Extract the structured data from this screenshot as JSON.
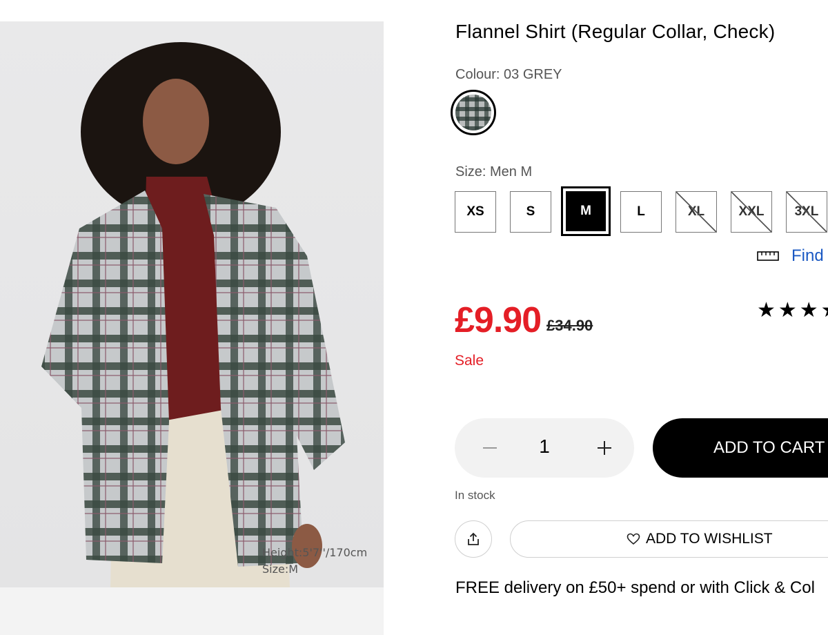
{
  "product": {
    "title": "Flannel Shirt (Regular Collar, Check)",
    "colour_label": "Colour: 03 GREY",
    "size_label": "Size: Men M",
    "sizes": [
      {
        "label": "XS",
        "available": true,
        "selected": false
      },
      {
        "label": "S",
        "available": true,
        "selected": false
      },
      {
        "label": "M",
        "available": true,
        "selected": true
      },
      {
        "label": "L",
        "available": true,
        "selected": false
      },
      {
        "label": "XL",
        "available": false,
        "selected": false
      },
      {
        "label": "XXL",
        "available": false,
        "selected": false
      },
      {
        "label": "3XL",
        "available": false,
        "selected": false
      }
    ],
    "find_size_link": "Find",
    "price": "£9.90",
    "original_price": "£34.90",
    "sale_label": "Sale",
    "rating_stars": "★★★★",
    "quantity": "1",
    "stock_status": "In stock"
  },
  "photo": {
    "caption_height": "Height:5'7''/170cm",
    "caption_size": "Size:M"
  },
  "actions": {
    "add_to_cart": "ADD TO CART",
    "add_to_wishlist": "ADD TO WISHLIST"
  },
  "delivery_text": "FREE delivery on £50+ spend or with Click & Col",
  "colors": {
    "sale_red": "#e41e26",
    "link_blue": "#1b59c3",
    "button_black": "#000000"
  }
}
